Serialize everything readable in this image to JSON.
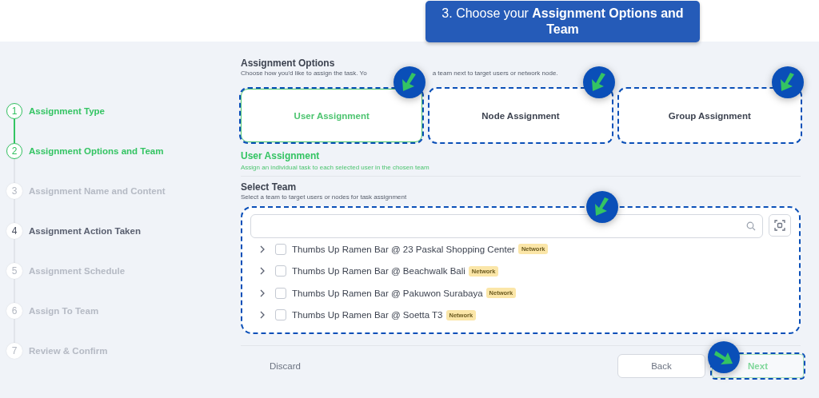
{
  "callout": {
    "text": "3. Choose your **Assignment Options and Team**"
  },
  "steps": [
    {
      "number": "1",
      "label": "Assignment Type",
      "highlighted": true,
      "disabled": false
    },
    {
      "number": "2",
      "label": "Assignment Options and Team",
      "highlighted": true,
      "disabled": false
    },
    {
      "number": "3",
      "label": "Assignment Name and Content",
      "highlighted": false,
      "disabled": true
    },
    {
      "number": "4",
      "label": "Assignment Action Taken",
      "highlighted": false,
      "disabled": false
    },
    {
      "number": "5",
      "label": "Assignment Schedule",
      "highlighted": false,
      "disabled": true
    },
    {
      "number": "6",
      "label": "Assign To Team",
      "highlighted": false,
      "disabled": true
    },
    {
      "number": "7",
      "label": "Review & Confirm",
      "highlighted": false,
      "disabled": true
    }
  ],
  "options": {
    "title": "Assignment Options",
    "description_parts": [
      "Choose how you'd like to assign the task. Yo",
      "a team next to target users or network node."
    ],
    "cards": [
      {
        "label": "User Assignment",
        "selected": true,
        "highlighted": true
      },
      {
        "label": "Node Assignment",
        "selected": false,
        "highlighted": true
      },
      {
        "label": "Group Assignment",
        "selected": false,
        "highlighted": true
      }
    ]
  },
  "selected_option": {
    "title": "User Assignment",
    "description": "Assign an individual task to each selected user in the chosen team"
  },
  "team": {
    "title": "Select Team",
    "description": "Select a team to target users or nodes for task assignment",
    "highlighted": true,
    "rows": [
      {
        "name": "Thumbs Up Ramen Bar @ 23 Paskal Shopping Center",
        "tag": "Network",
        "checked": false,
        "expanded": false
      },
      {
        "name": "Thumbs Up Ramen Bar @ Beachwalk Bali",
        "tag": "Network",
        "checked": false,
        "expanded": false
      },
      {
        "name": "Thumbs Up Ramen Bar @ Pakuwon Surabaya",
        "tag": "Network",
        "checked": false,
        "expanded": false
      },
      {
        "name": "Thumbs Up Ramen Bar @ Soetta T3",
        "tag": "Network",
        "checked": false,
        "expanded": false
      }
    ]
  },
  "footer": {
    "discard": "Discard",
    "back": "Back",
    "next": {
      "label": "Next",
      "highlighted": true
    }
  }
}
